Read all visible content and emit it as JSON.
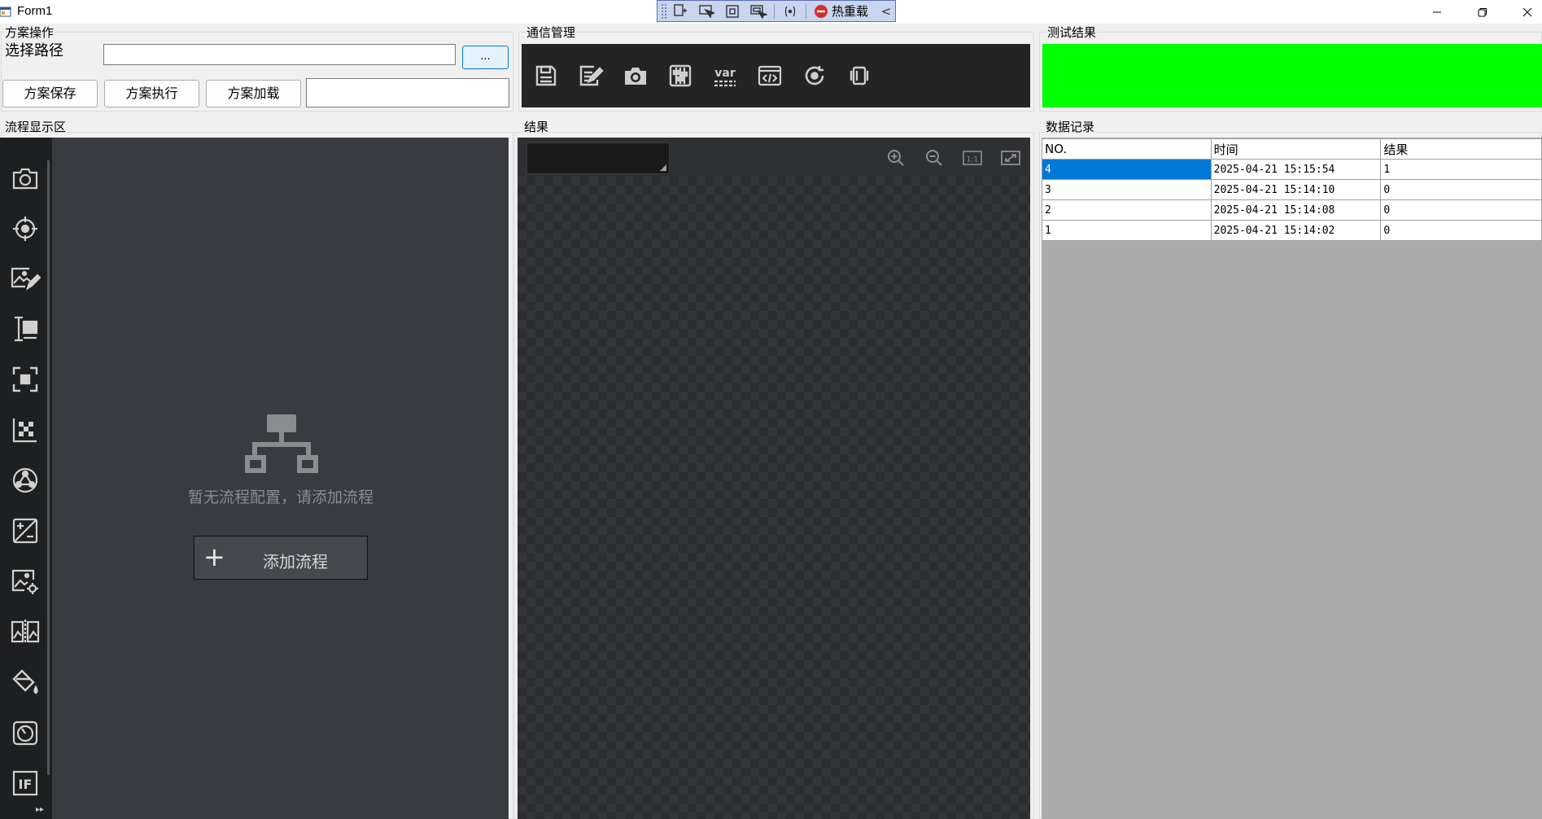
{
  "window": {
    "title": "Form1",
    "minimize_glyph": "—",
    "restore_glyph": "❐",
    "close_glyph": "✕"
  },
  "debug_toolbar": {
    "hot_reload_label": "热重载",
    "collapse_glyph": "<"
  },
  "scheme_ops": {
    "group_label": "方案操作",
    "path_label": "选择路径",
    "path_value": "",
    "browse_label": "...",
    "save_label": "方案保存",
    "execute_label": "方案执行",
    "load_label": "方案加载",
    "scheme_name_value": ""
  },
  "comm": {
    "group_label": "通信管理",
    "icons": [
      "save-icon",
      "edit-icon",
      "camera-icon",
      "sliders-icon",
      "variable-icon",
      "script-icon",
      "refresh-target-icon",
      "device-icon"
    ]
  },
  "test_result": {
    "group_label": "测试结果",
    "color": "#00ff00"
  },
  "flow": {
    "group_label": "流程显示区",
    "empty_text": "暂无流程配置，请添加流程",
    "add_label": "添加流程",
    "add_plus": "+",
    "more_glyph": "▸▸",
    "tool_icons": [
      "camera-icon",
      "locate-icon",
      "image-edit-icon",
      "measure-icon",
      "focus-icon",
      "calibrate-icon",
      "network-icon",
      "calc-icon",
      "image-settings-icon",
      "compare-icon",
      "fill-icon",
      "timer-icon",
      "if-icon"
    ]
  },
  "result_view": {
    "group_label": "结果"
  },
  "data_log": {
    "group_label": "数据记录",
    "columns": [
      "NO.",
      "时间",
      "结果"
    ],
    "rows": [
      [
        "4",
        "2025-04-21 15:15:54",
        "1"
      ],
      [
        "3",
        "2025-04-21 15:14:10",
        "0"
      ],
      [
        "2",
        "2025-04-21 15:14:08",
        "0"
      ],
      [
        "1",
        "2025-04-21 15:14:02",
        "0"
      ]
    ]
  },
  "colors": {
    "accent": "#0078d7",
    "pass_green": "#00ff00",
    "dark_panel": "#383b3f"
  }
}
